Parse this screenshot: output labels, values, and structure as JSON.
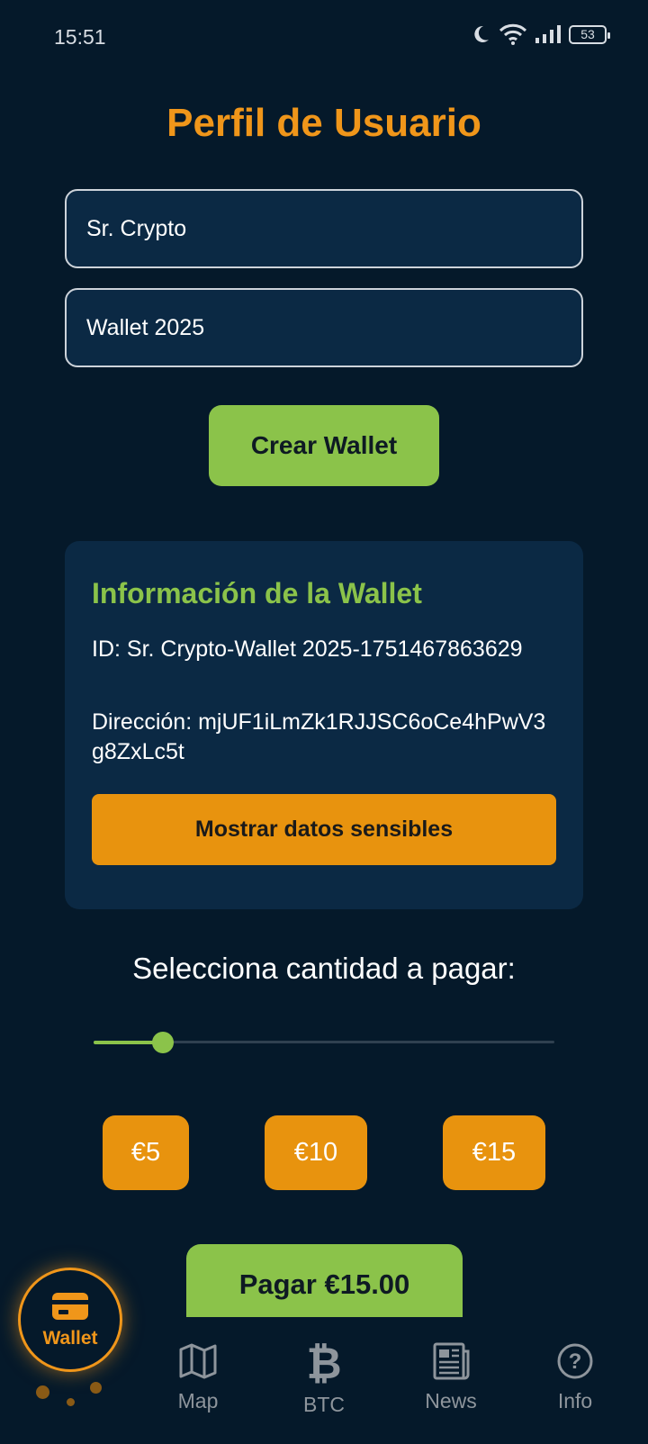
{
  "status": {
    "time": "15:51",
    "battery": "53"
  },
  "profile": {
    "title": "Perfil de Usuario",
    "name_value": "Sr. Crypto",
    "wallet_name_value": "Wallet 2025",
    "create_button": "Crear Wallet"
  },
  "wallet_info": {
    "title": "Información de la Wallet",
    "id_text": "ID: Sr. Crypto-Wallet 2025-1751467863629",
    "address_text": "Dirección: mjUF1iLmZk1RJJSC6oCe4hPwV3g8ZxLc5t",
    "sensitive_button": "Mostrar datos sensibles"
  },
  "payment": {
    "label": "Selecciona cantidad a pagar:",
    "slider_fraction": 0.15,
    "amounts": [
      "€5",
      "€10",
      "€15"
    ],
    "pay_button": "Pagar €15.00"
  },
  "nav": {
    "wallet": "Wallet",
    "map": "Map",
    "btc": "BTC",
    "news": "News",
    "info": "Info"
  },
  "colors": {
    "background": "#05192a",
    "card": "#0b2944",
    "accent_orange": "#f0961a",
    "accent_green": "#8bc34a"
  }
}
